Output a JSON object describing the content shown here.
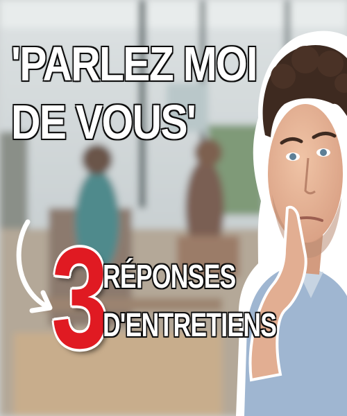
{
  "headline": {
    "line1": "'PARLEZ MOI",
    "line2": "DE VOUS'"
  },
  "number": "3",
  "subtitle": {
    "line1": "RÉPONSES",
    "line2": "D'ENTRETIENS"
  },
  "colors": {
    "accent_red": "#e01a22",
    "text_white": "#ffffff",
    "shirt_blue": "#9fb6d1"
  },
  "icons": [
    "curved-arrow-icon"
  ]
}
